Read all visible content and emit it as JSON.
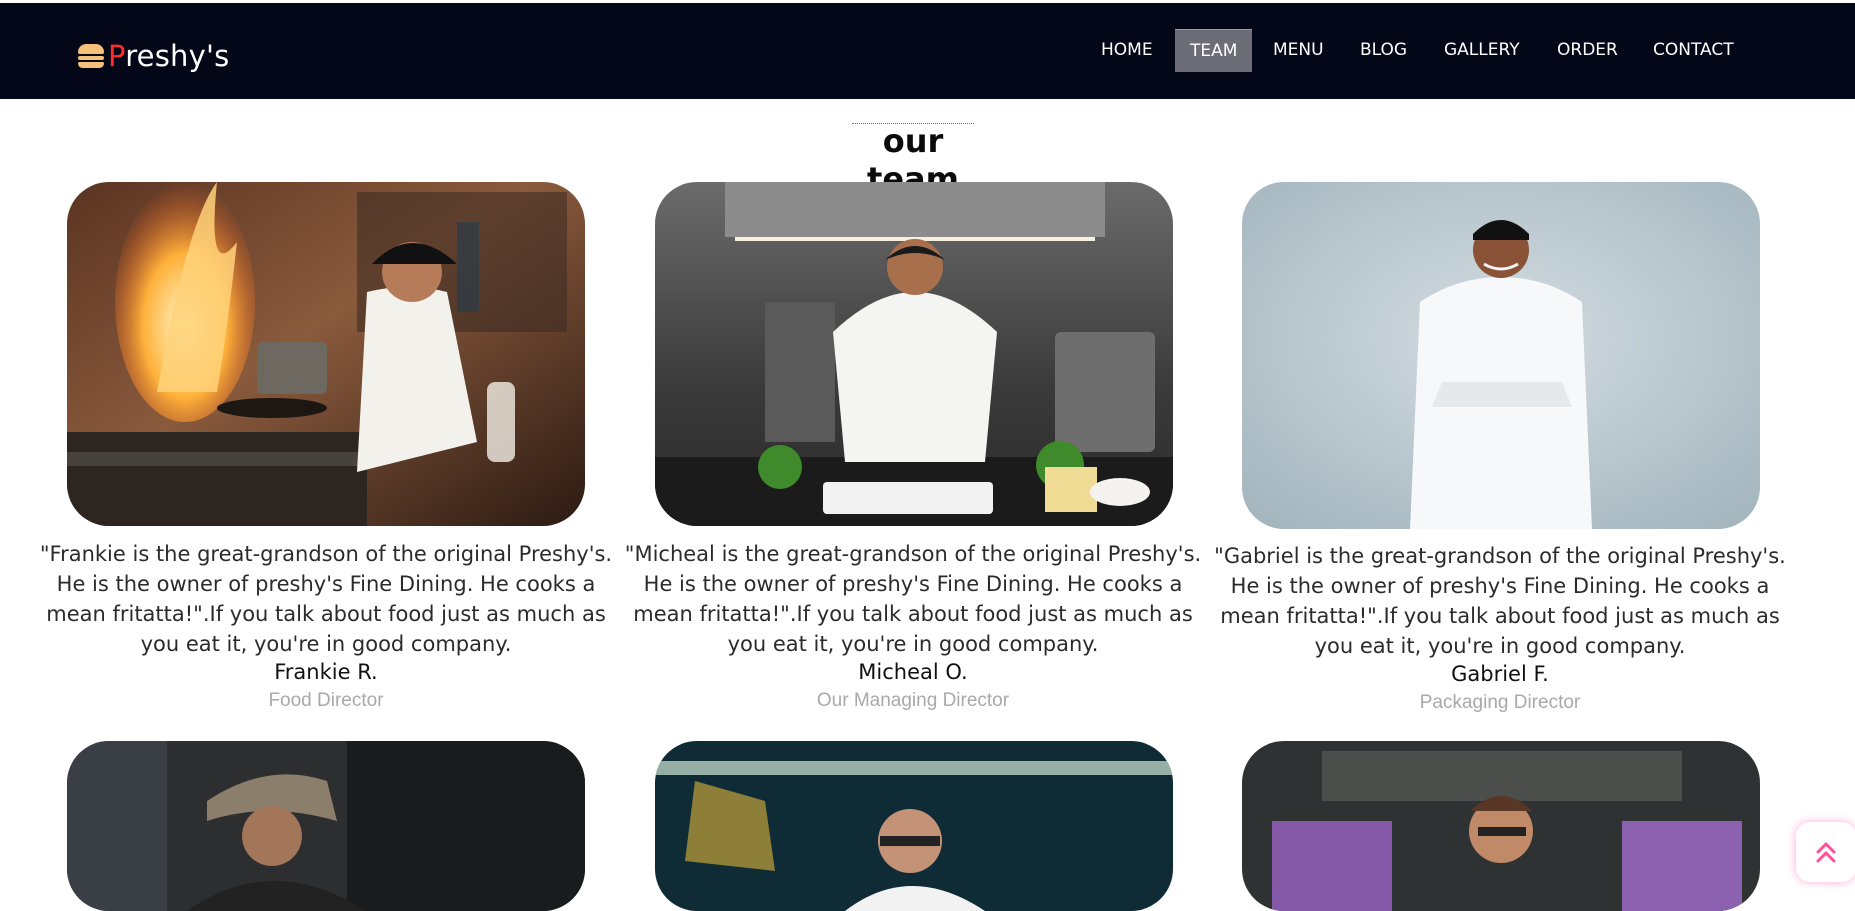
{
  "brand": {
    "first_letter": "P",
    "rest": "reshy's",
    "icon": "burger-icon"
  },
  "nav": {
    "items": [
      {
        "label": "HOME",
        "active": false
      },
      {
        "label": "TEAM",
        "active": true
      },
      {
        "label": "MENU",
        "active": false
      },
      {
        "label": "BLOG",
        "active": false
      },
      {
        "label": "GALLERY",
        "active": false
      },
      {
        "label": "ORDER",
        "active": false
      },
      {
        "label": "CONTACT",
        "active": false
      }
    ]
  },
  "section": {
    "title": "our team"
  },
  "team": [
    {
      "quote": "\"Frankie is the great-grandson of the original Preshy's. He is the owner of preshy's Fine Dining. He cooks a mean fritatta!\".If you talk about food just as much as you eat it, you're in good company.",
      "name": "Frankie R.",
      "role": "Food Director",
      "photo": "chef-flambe-photo"
    },
    {
      "quote": "\"Micheal is the great-grandson of the original Preshy's. He is the owner of preshy's Fine Dining. He cooks a mean fritatta!\".If you talk about food just as much as you eat it, you're in good company.",
      "name": "Micheal O.",
      "role": "Our Managing Director",
      "photo": "chef-kitchen-photo"
    },
    {
      "quote": "\"Gabriel is the great-grandson of the original Preshy's. He is the owner of preshy's Fine Dining. He cooks a mean fritatta!\".If you talk about food just as much as you eat it, you're in good company.",
      "name": "Gabriel F.",
      "role": "Packaging Director",
      "photo": "chef-studio-photo"
    }
  ],
  "colors": {
    "navbar": "#030718",
    "active_tab": "#6d6d78",
    "brand_accent": "#ff2a2a",
    "role_text": "#a9a9a9",
    "scroll_button_icon": "#ff4f9a"
  },
  "scroll_top": {
    "icon": "double-chevron-up-icon"
  }
}
